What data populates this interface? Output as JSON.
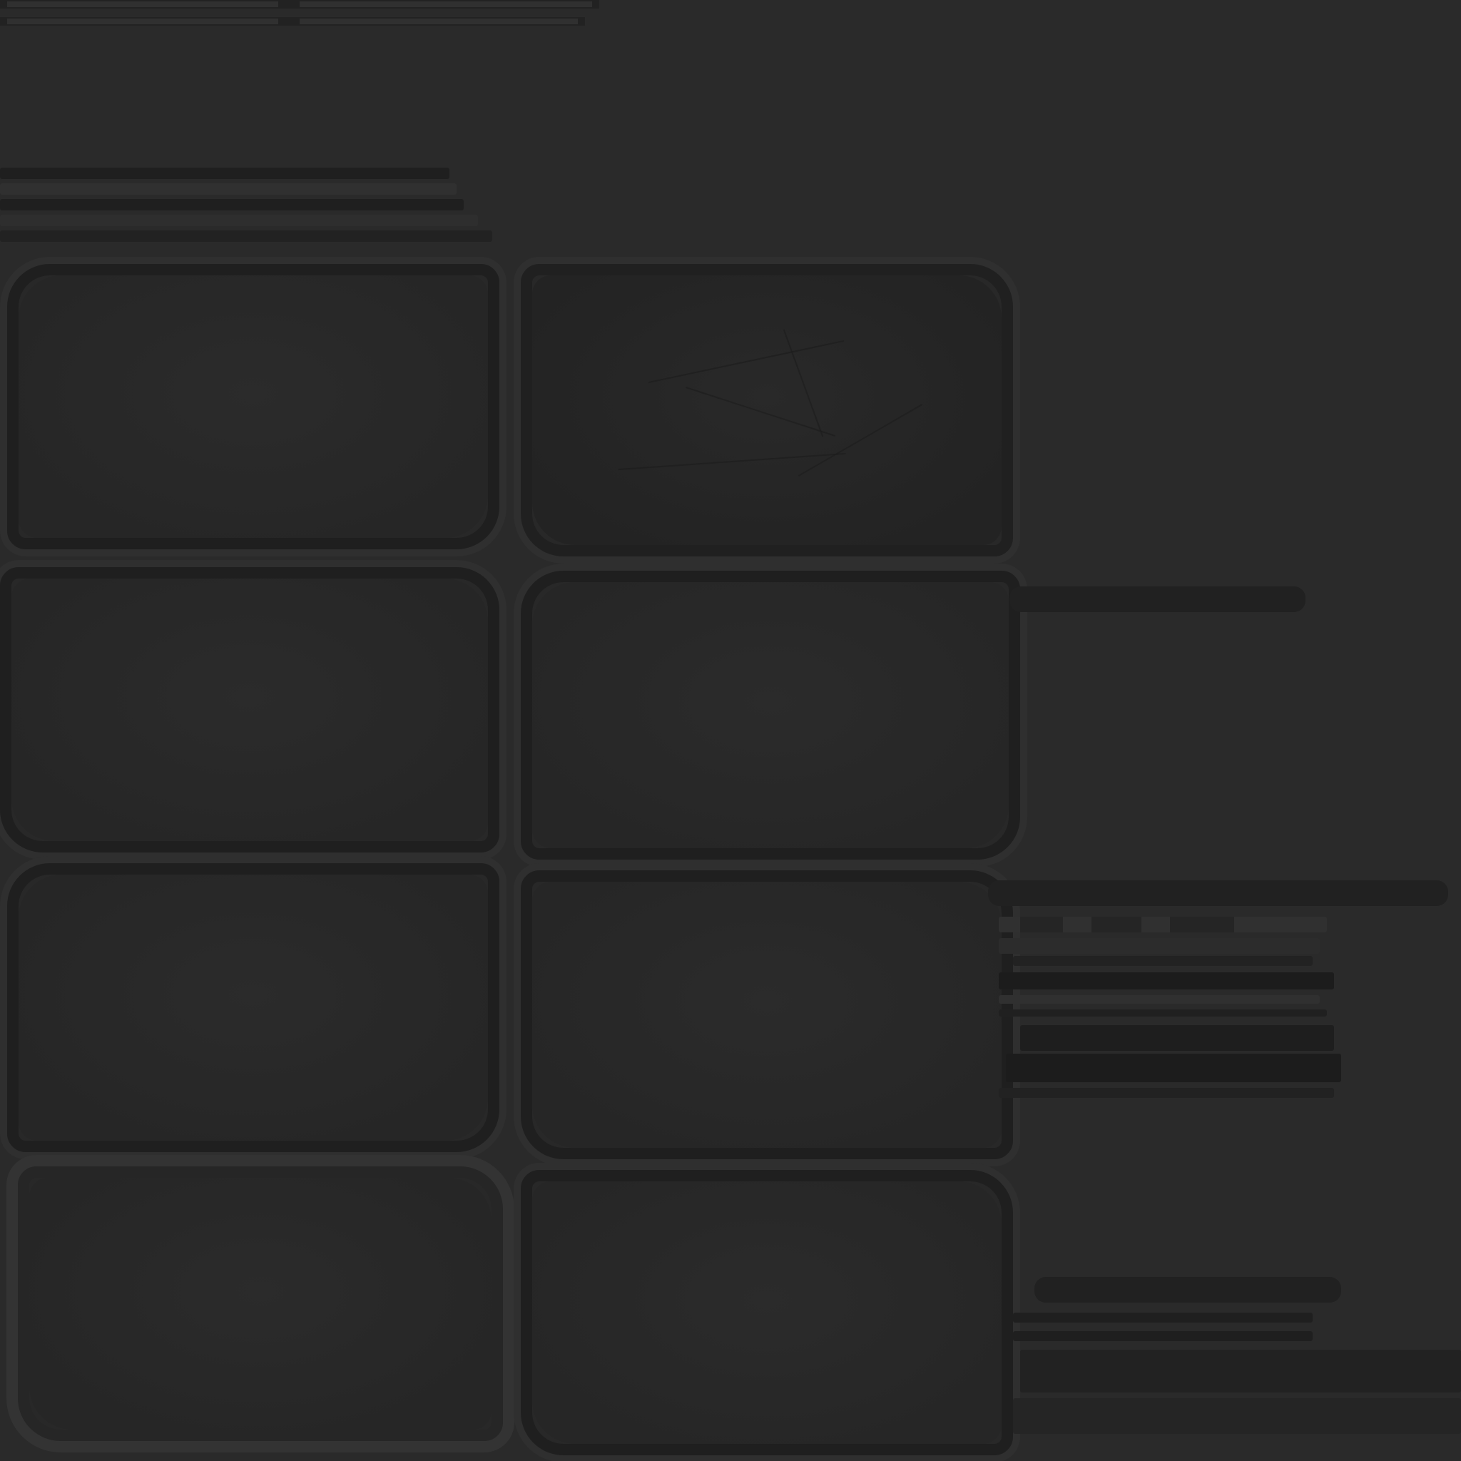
{
  "canvas": {
    "background": "#2a2a2a",
    "panel_fill": "#282828",
    "panel_border": "#1f1f1f",
    "panel_outline": "#2f2f2f"
  },
  "panels": [
    {
      "id": "panel-r1-left"
    },
    {
      "id": "panel-r1-right"
    },
    {
      "id": "panel-r2-left"
    },
    {
      "id": "panel-r2-right"
    },
    {
      "id": "panel-r3-left"
    },
    {
      "id": "panel-r3-right"
    },
    {
      "id": "panel-r4-left"
    },
    {
      "id": "panel-r4-right"
    }
  ]
}
